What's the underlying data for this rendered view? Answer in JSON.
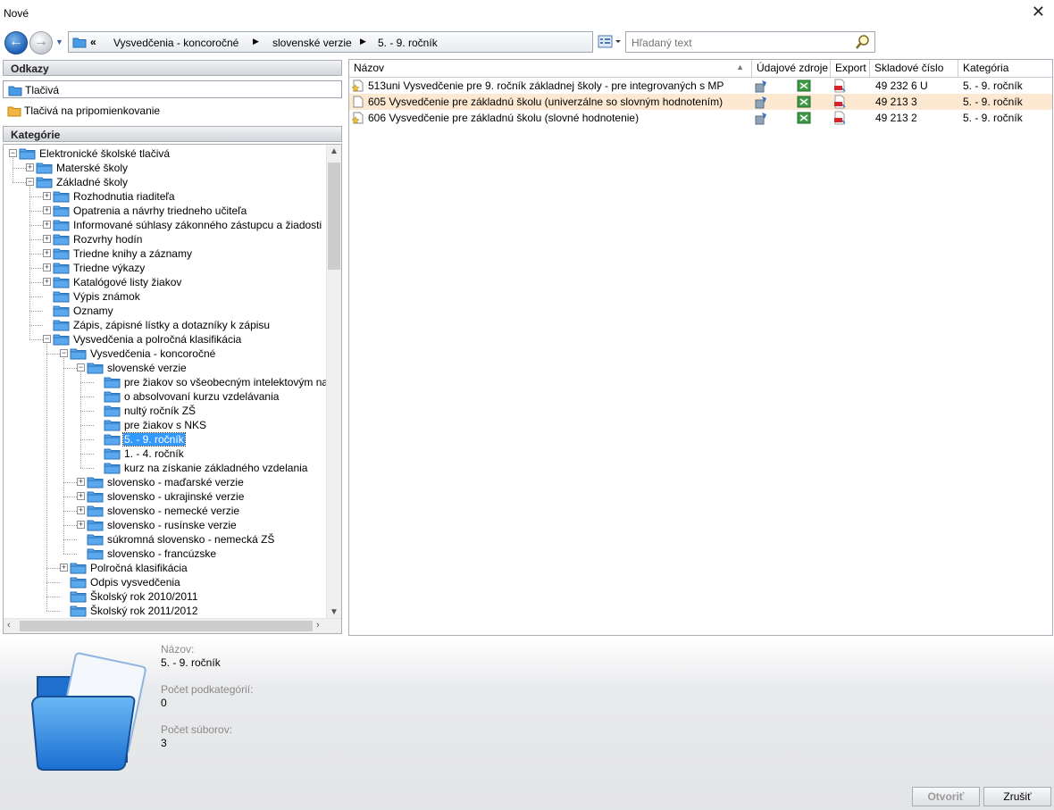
{
  "window": {
    "title": "Nové",
    "close_glyph": "✕"
  },
  "toolbar": {
    "back_glyph": "←",
    "forward_glyph": "→",
    "overflow_glyph": "«",
    "breadcrumbs": [
      "Vysvedčenia - koncoročné",
      "slovenské verzie",
      "5. - 9. ročník"
    ],
    "separator": "▶",
    "search_placeholder": "Hľadaný text"
  },
  "links": {
    "header": "Odkazy",
    "items": [
      "Tlačivá",
      "Tlačivá na pripomienkovanie"
    ]
  },
  "categories": {
    "header": "Kategórie",
    "tree": [
      {
        "label": "Elektronické školské tlačivá",
        "depth": 0,
        "state": "open"
      },
      {
        "label": "Materské školy",
        "depth": 1,
        "state": "closed"
      },
      {
        "label": "Základné školy",
        "depth": 1,
        "state": "open"
      },
      {
        "label": "Rozhodnutia riaditeľa",
        "depth": 2,
        "state": "closed"
      },
      {
        "label": "Opatrenia a návrhy  triedneho učiteľa",
        "depth": 2,
        "state": "closed"
      },
      {
        "label": "Informované súhlasy zákonného zástupcu a žiadosti",
        "depth": 2,
        "state": "closed"
      },
      {
        "label": "Rozvrhy hodín",
        "depth": 2,
        "state": "closed"
      },
      {
        "label": "Triedne knihy a záznamy",
        "depth": 2,
        "state": "closed"
      },
      {
        "label": "Triedne výkazy",
        "depth": 2,
        "state": "closed"
      },
      {
        "label": "Katalógové listy žiakov",
        "depth": 2,
        "state": "closed"
      },
      {
        "label": "Výpis známok",
        "depth": 2,
        "state": "leaf"
      },
      {
        "label": "Oznamy",
        "depth": 2,
        "state": "leaf"
      },
      {
        "label": "Zápis, zápisné lístky a dotazníky k zápisu",
        "depth": 2,
        "state": "leaf"
      },
      {
        "label": "Vysvedčenia a polročná klasifikácia",
        "depth": 2,
        "state": "open"
      },
      {
        "label": "Vysvedčenia - koncoročné",
        "depth": 3,
        "state": "open"
      },
      {
        "label": "slovenské verzie",
        "depth": 4,
        "state": "open"
      },
      {
        "label": "pre žiakov so všeobecným intelektovým nad",
        "depth": 5,
        "state": "leaf"
      },
      {
        "label": "o absolvovaní kurzu vzdelávania",
        "depth": 5,
        "state": "leaf"
      },
      {
        "label": "nultý ročník ZŠ",
        "depth": 5,
        "state": "leaf"
      },
      {
        "label": "pre žiakov s NKS",
        "depth": 5,
        "state": "leaf"
      },
      {
        "label": "5. - 9. ročník",
        "depth": 5,
        "state": "leaf",
        "selected": true
      },
      {
        "label": "1. - 4. ročník",
        "depth": 5,
        "state": "leaf"
      },
      {
        "label": "kurz na získanie základného vzdelania",
        "depth": 5,
        "state": "leaf"
      },
      {
        "label": "slovensko - maďarské verzie",
        "depth": 4,
        "state": "closed"
      },
      {
        "label": "slovensko - ukrajinské verzie",
        "depth": 4,
        "state": "closed"
      },
      {
        "label": "slovensko - nemecké verzie",
        "depth": 4,
        "state": "closed"
      },
      {
        "label": "slovensko - rusínske verzie",
        "depth": 4,
        "state": "closed"
      },
      {
        "label": "súkromná slovensko - nemecká ZŠ",
        "depth": 4,
        "state": "leaf"
      },
      {
        "label": "slovensko - francúzske",
        "depth": 4,
        "state": "leaf"
      },
      {
        "label": "Polročná klasifikácia",
        "depth": 3,
        "state": "closed"
      },
      {
        "label": "Odpis vysvedčenia",
        "depth": 3,
        "state": "leaf"
      },
      {
        "label": "Školský rok 2010/2011",
        "depth": 3,
        "state": "leaf"
      },
      {
        "label": "Školský rok 2011/2012",
        "depth": 3,
        "state": "leaf"
      }
    ]
  },
  "grid": {
    "columns": [
      "Názov",
      "Údajové zdroje",
      "Export",
      "Skladové číslo",
      "Kategória"
    ],
    "sort_glyph": "▲",
    "rows": [
      {
        "name": "513uni Vysvedčenie pre 9. ročník základnej školy - pre integrovaných s MP",
        "stock": "49  232 6 U",
        "category": "5. - 9. ročník",
        "icon": "star-doc-icon",
        "highlight": false
      },
      {
        "name": "605 Vysvedčenie pre základnú školu (univerzálne so slovným hodnotením)",
        "stock": "49  213 3",
        "category": "5. - 9. ročník",
        "icon": "doc-icon",
        "highlight": true
      },
      {
        "name": "606 Vysvedčenie pre základnú školu (slovné hodnotenie)",
        "stock": "49  213 2",
        "category": "5. - 9. ročník",
        "icon": "star-doc-icon",
        "highlight": false
      }
    ]
  },
  "details": {
    "name_label": "Názov:",
    "name_value": "5. - 9. ročník",
    "subcat_label": "Počet podkategórií:",
    "subcat_value": "0",
    "files_label": "Počet súborov:",
    "files_value": "3"
  },
  "buttons": {
    "open": "Otvoriť",
    "cancel": "Zrušiť"
  },
  "colors": {
    "selected": "#3399ff",
    "row_highlight": "#fde9d2",
    "folder": "#3b8de0"
  }
}
